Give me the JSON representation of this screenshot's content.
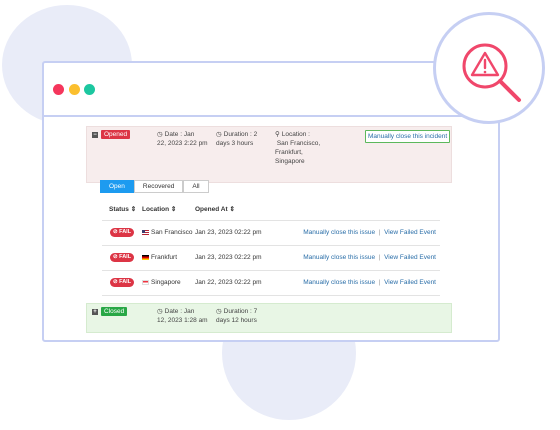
{
  "colors": {
    "accent": "#1d9bf0",
    "danger": "#dc3545",
    "success": "#28a745",
    "link": "#2a6ea8",
    "frame": "#c6cff3"
  },
  "icons": {
    "alert": "magnifier-alert-icon"
  },
  "opened_incident": {
    "status": "Opened",
    "date_label": "Date :",
    "date_line1": "Jan",
    "date_line2": "22, 2023 2:22 pm",
    "duration_label": "Duration :",
    "duration_line1": "2",
    "duration_line2": "days 3 hours",
    "location_label": "Location :",
    "location_lines": [
      "San Francisco,",
      "Frankfurt,",
      "Singapore"
    ],
    "close_button": "Manually close this incident"
  },
  "tabs": [
    "Open",
    "Recovered",
    "All"
  ],
  "table": {
    "headers": [
      "Status",
      "Location",
      "Opened At"
    ],
    "rows": [
      {
        "status": "FAIL",
        "location": "San Francisco",
        "opened_at": "Jan 23, 2023 02:22 pm",
        "action1": "Manually close this issue",
        "sep": "|",
        "action2": "View Failed Event"
      },
      {
        "status": "FAIL",
        "location": "Frankfurt",
        "opened_at": "Jan 23, 2023 02:22 pm",
        "action1": "Manually close this issue",
        "sep": "|",
        "action2": "View Failed Event"
      },
      {
        "status": "FAIL",
        "location": "Singapore",
        "opened_at": "Jan 22, 2023 02:22 pm",
        "action1": "Manually close this issue",
        "sep": "|",
        "action2": "View Failed Event"
      }
    ]
  },
  "closed_incident": {
    "status": "Closed",
    "date_label": "Date :",
    "date_line1": "Jan",
    "date_line2": "12, 2023 1:28 am",
    "duration_label": "Duration :",
    "duration_line1": "7",
    "duration_line2": "days 12 hours"
  }
}
